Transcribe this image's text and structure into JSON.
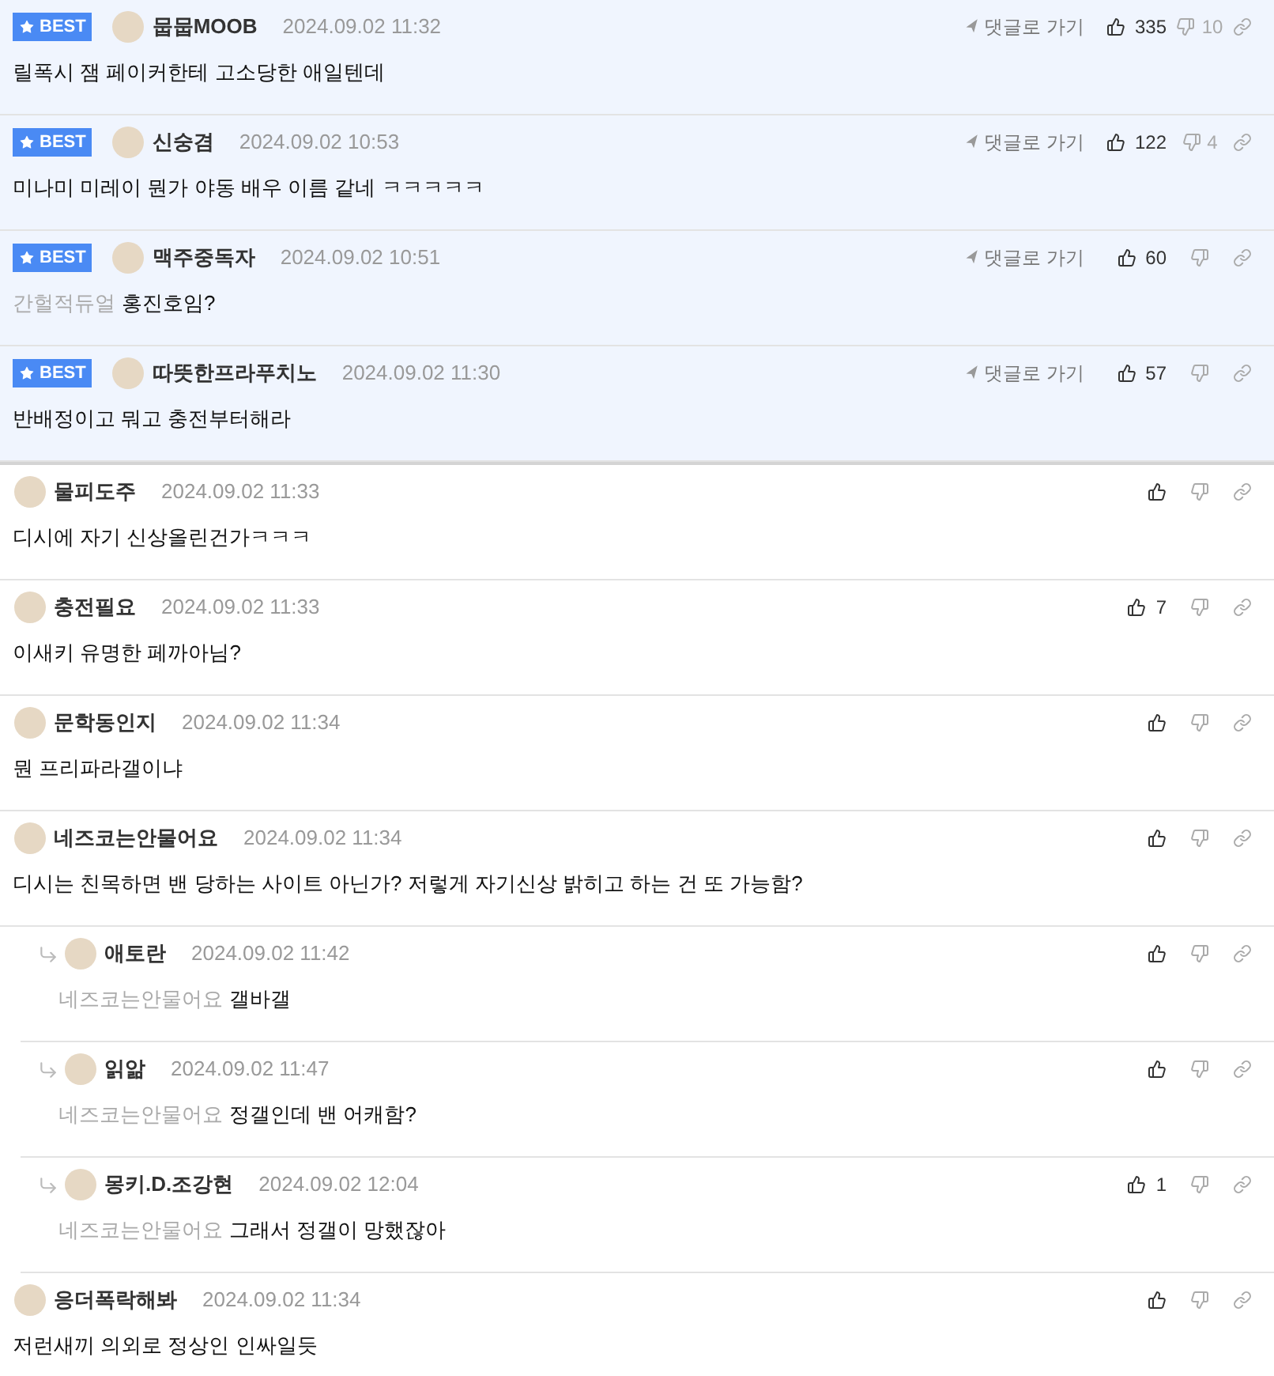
{
  "comments": [
    {
      "badge": "BEST",
      "author": "뭅뭅MOOB",
      "time": "2024.09.02 11:32",
      "text": "릴폭시 잼 페이커한테 고소당한 애일텐데",
      "goto": "댓글로 가기",
      "likes": "335",
      "dislikes": "10"
    },
    {
      "badge": "BEST",
      "author": "신숭겸",
      "time": "2024.09.02 10:53",
      "text": "미나미 미레이 뭔가 야동 배우 이름 같네 ㅋㅋㅋㅋㅋ",
      "goto": "댓글로 가기",
      "likes": "122",
      "dislikes": "4"
    },
    {
      "badge": "BEST",
      "author": "맥주중독자",
      "time": "2024.09.02 10:51",
      "mention": "간헐적듀얼",
      "text": "홍진호임?",
      "goto": "댓글로 가기",
      "likes": "60"
    },
    {
      "badge": "BEST",
      "author": "따뜻한프라푸치노",
      "time": "2024.09.02 11:30",
      "text": "반배정이고 뭐고 충전부터해라",
      "goto": "댓글로 가기",
      "likes": "57"
    },
    {
      "author": "물피도주",
      "time": "2024.09.02 11:33",
      "text": "디시에 자기 신상올린건가ㅋㅋㅋ"
    },
    {
      "author": "충전필요",
      "time": "2024.09.02 11:33",
      "text": "이새키 유명한 페까아님?",
      "likes": "7"
    },
    {
      "author": "문학동인지",
      "time": "2024.09.02 11:34",
      "text": "뭔 프리파라갤이냐"
    },
    {
      "author": "네즈코는안물어요",
      "time": "2024.09.02 11:34",
      "text": "디시는 친목하면 밴 당하는 사이트 아닌가? 저렇게 자기신상 밝히고 하는 건 또 가능함?",
      "children": [
        {
          "author": "애토란",
          "time": "2024.09.02 11:42",
          "mention": "네즈코는안물어요",
          "text": "갤바갤"
        },
        {
          "author": "읽앎",
          "time": "2024.09.02 11:47",
          "mention": "네즈코는안물어요",
          "text": "정갤인데 밴 어캐함?"
        },
        {
          "author": "몽키.D.조강현",
          "time": "2024.09.02 12:04",
          "mention": "네즈코는안물어요",
          "text": "그래서 정갤이 망했잖아",
          "likes": "1"
        }
      ]
    },
    {
      "author": "응더폭락해봐",
      "time": "2024.09.02 11:34",
      "text": "저런새끼 의외로 정상인 인싸일듯"
    }
  ]
}
